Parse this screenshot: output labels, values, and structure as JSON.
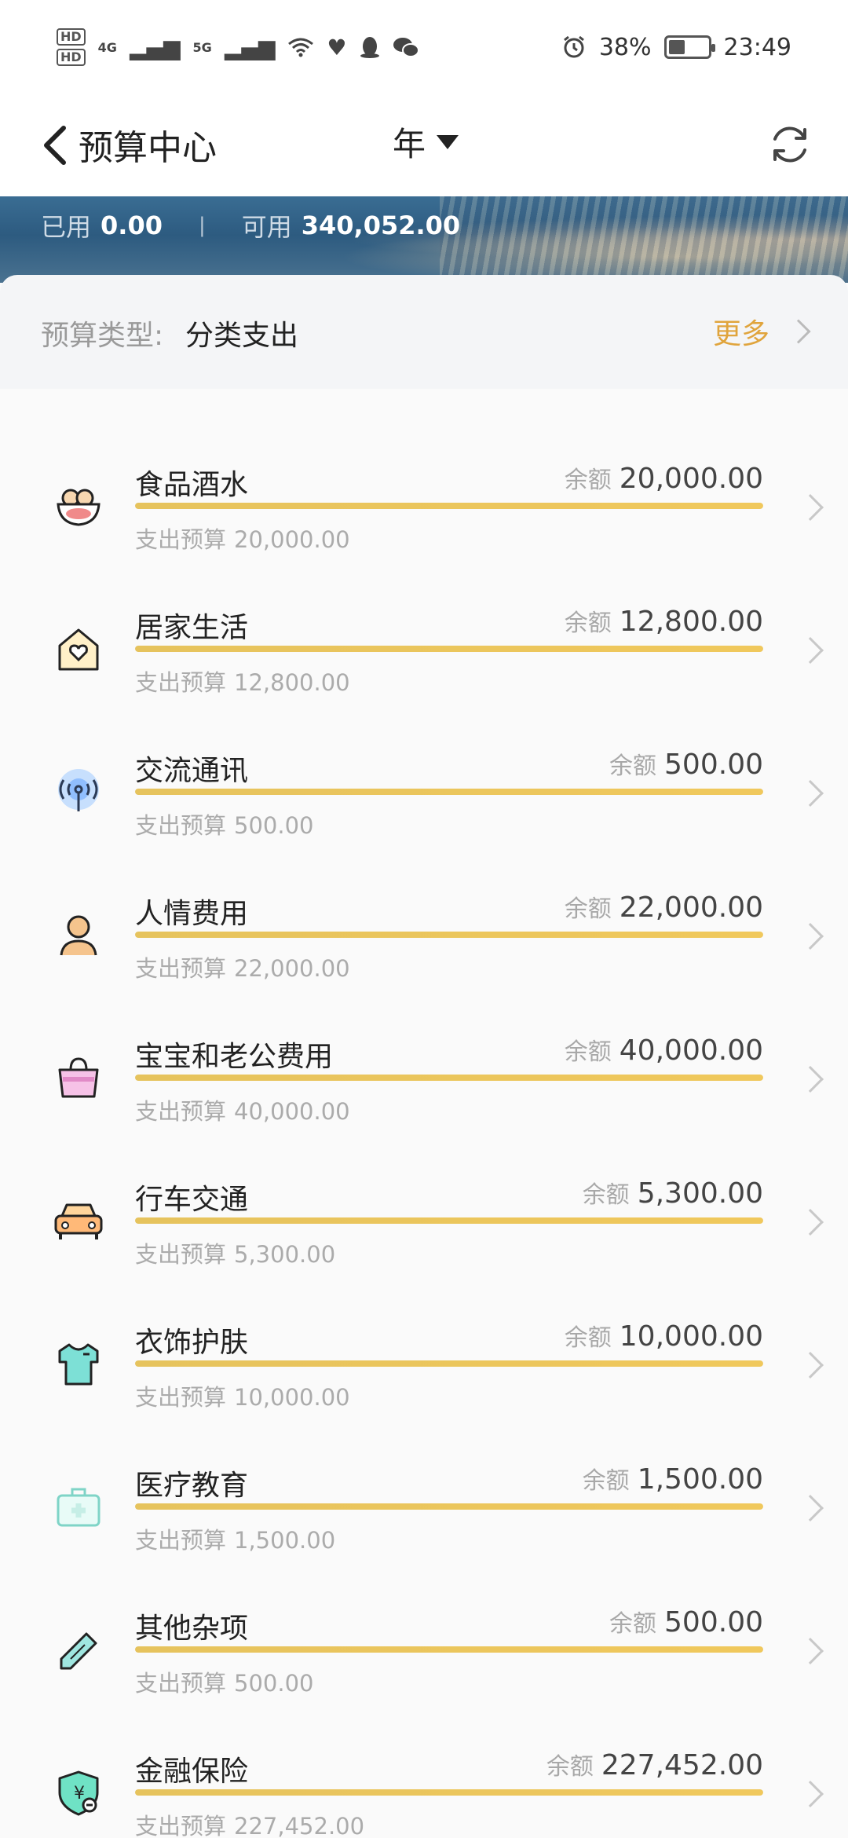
{
  "status_bar": {
    "battery_percent": "38%",
    "time": "23:49",
    "network_1": "4G",
    "network_2": "5G",
    "hd1": "HD",
    "hd2": "HD"
  },
  "header": {
    "title": "预算中心",
    "period_selector": "年"
  },
  "banner": {
    "used_label": "已用",
    "used_value": "0.00",
    "available_label": "可用",
    "available_value": "340,052.00"
  },
  "budget_type": {
    "label": "预算类型:",
    "value": "分类支出",
    "more": "更多"
  },
  "categories": [
    {
      "name": "食品酒水",
      "balance_label": "余额",
      "balance": "20,000.00",
      "plan_label": "支出预算",
      "plan": "20,000.00",
      "progress": 1.0,
      "icon": "food-bowl-icon"
    },
    {
      "name": "居家生活",
      "balance_label": "余额",
      "balance": "12,800.00",
      "plan_label": "支出预算",
      "plan": "12,800.00",
      "progress": 1.0,
      "icon": "home-heart-icon"
    },
    {
      "name": "交流通讯",
      "balance_label": "余额",
      "balance": "500.00",
      "plan_label": "支出预算",
      "plan": "500.00",
      "progress": 1.0,
      "icon": "signal-antenna-icon"
    },
    {
      "name": "人情费用",
      "balance_label": "余额",
      "balance": "22,000.00",
      "plan_label": "支出预算",
      "plan": "22,000.00",
      "progress": 1.0,
      "icon": "person-icon"
    },
    {
      "name": "宝宝和老公费用",
      "balance_label": "余额",
      "balance": "40,000.00",
      "plan_label": "支出预算",
      "plan": "40,000.00",
      "progress": 1.0,
      "icon": "shopping-bag-icon"
    },
    {
      "name": "行车交通",
      "balance_label": "余额",
      "balance": "5,300.00",
      "plan_label": "支出预算",
      "plan": "5,300.00",
      "progress": 1.0,
      "icon": "car-icon"
    },
    {
      "name": "衣饰护肤",
      "balance_label": "余额",
      "balance": "10,000.00",
      "plan_label": "支出预算",
      "plan": "10,000.00",
      "progress": 1.0,
      "icon": "shirt-icon"
    },
    {
      "name": "医疗教育",
      "balance_label": "余额",
      "balance": "1,500.00",
      "plan_label": "支出预算",
      "plan": "1,500.00",
      "progress": 1.0,
      "icon": "medical-kit-icon"
    },
    {
      "name": "其他杂项",
      "balance_label": "余额",
      "balance": "500.00",
      "plan_label": "支出预算",
      "plan": "500.00",
      "progress": 1.0,
      "icon": "pencil-icon"
    },
    {
      "name": "金融保险",
      "balance_label": "余额",
      "balance": "227,452.00",
      "plan_label": "支出预算",
      "plan": "227,452.00",
      "progress": 1.0,
      "icon": "shield-yen-icon"
    }
  ],
  "colors": {
    "accent": "#e0a43c",
    "progress": "#e9c35c"
  }
}
